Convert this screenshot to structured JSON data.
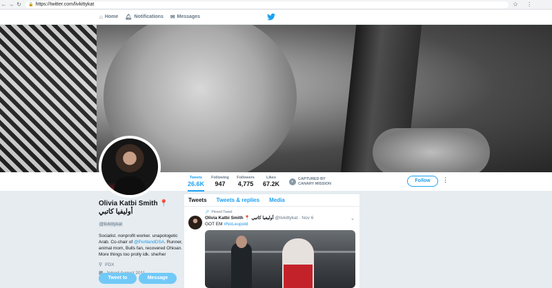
{
  "browser": {
    "url": "https://twitter.com/livkittykat"
  },
  "nav": {
    "home": "Home",
    "notifications": "Notifications",
    "messages": "Messages"
  },
  "profile": {
    "stats": [
      {
        "label": "Tweets",
        "value": "26.6K"
      },
      {
        "label": "Following",
        "value": "947"
      },
      {
        "label": "Followers",
        "value": "4,775"
      },
      {
        "label": "Likes",
        "value": "67.2K"
      }
    ],
    "canary_line1": "CAPTURED BY",
    "canary_line2": "CANARY MISSION",
    "follow_label": "Follow",
    "name": "Olivia Katbi Smith 📍 أوليفيا كاتبي",
    "handle": "@livkittykat",
    "bio_part1": "Socialist. nonprofit worker. unapologetic Arab. Co-chair of ",
    "bio_link": "@PortlandDSA",
    "bio_part2": ". Runner, animal mom, Bulls fan, recovered Ohioan. More things too prolly idk. she/her",
    "location": "PDX",
    "joined": "Joined August 2011",
    "tweet_to_label": "Tweet to",
    "message_label": "Message"
  },
  "timeline": {
    "tabs": [
      "Tweets",
      "Tweets & replies",
      "Media"
    ],
    "pinned_label": "Pinned Tweet",
    "tweet": {
      "name": "Olivia Katbi Smith 📍 أوليفيا كاتبي",
      "handle_date": "@livkittykat · Nov 6",
      "text": "GOT EM ",
      "hashtag": "#NoLeupold"
    }
  },
  "colors": {
    "accent": "#1da1f2",
    "background": "#e6ecf0"
  }
}
